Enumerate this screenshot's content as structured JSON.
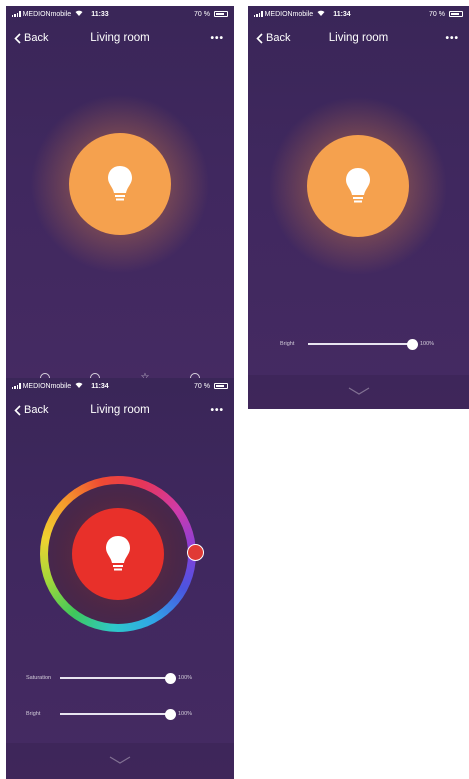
{
  "status_bars": [
    {
      "carrier": "MEDIONmobile",
      "time": "11:33",
      "battery": "70 %"
    },
    {
      "carrier": "MEDIONmobile",
      "time": "11:34",
      "battery": "70 %"
    },
    {
      "carrier": "MEDIONmobile",
      "time": "11:34",
      "battery": "70 %"
    }
  ],
  "nav": {
    "back_label": "Back",
    "title": "Living room",
    "more_icon": "more-dots-icon"
  },
  "screen2": {
    "bright": {
      "label": "Bright",
      "value": "100%",
      "level": 1.0
    }
  },
  "screen3": {
    "saturation": {
      "label": "Saturation",
      "value": "100%",
      "level": 1.0
    },
    "bright": {
      "label": "Bright",
      "value": "100%",
      "level": 1.0
    }
  },
  "colors": {
    "background": "#3f285e",
    "bulb_warm": "#f5a14e",
    "bulb_red": "#e8302a",
    "ring_handle": "#e03a35"
  },
  "icons": [
    "bulb-icon",
    "chevron-down-icon",
    "back-chevron-icon",
    "signal-icon",
    "wifi-icon",
    "battery-icon"
  ]
}
